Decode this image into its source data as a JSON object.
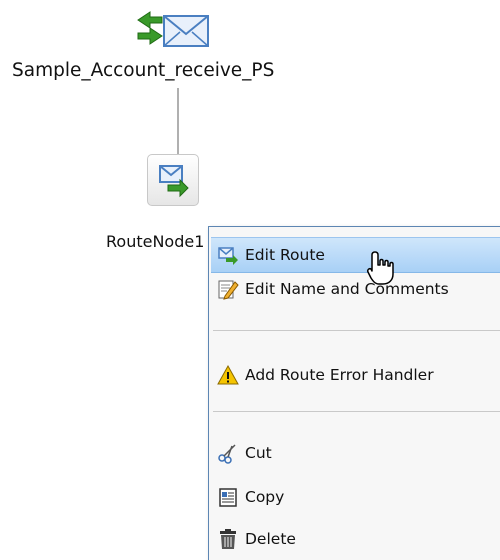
{
  "canvas": {
    "proxy_service_label": "Sample_Account_receive_PS",
    "route_node_label": "RouteNode1"
  },
  "context_menu": {
    "items": [
      {
        "label": "Edit Route",
        "icon": "edit-route-icon",
        "highlighted": true
      },
      {
        "label": "Edit Name and Comments",
        "icon": "pencil-icon"
      },
      {
        "label": "Add Route Error Handler",
        "icon": "warning-icon"
      },
      {
        "label": "Cut",
        "icon": "scissors-icon"
      },
      {
        "label": "Copy",
        "icon": "copy-icon"
      },
      {
        "label": "Delete",
        "icon": "trash-icon"
      }
    ]
  },
  "colors": {
    "menu_border": "#5d86b3",
    "highlight": "#a8d0f6",
    "envelope_blue": "#4a7fc1",
    "arrow_green": "#3a9a2a",
    "warning_yellow": "#f5c400"
  }
}
